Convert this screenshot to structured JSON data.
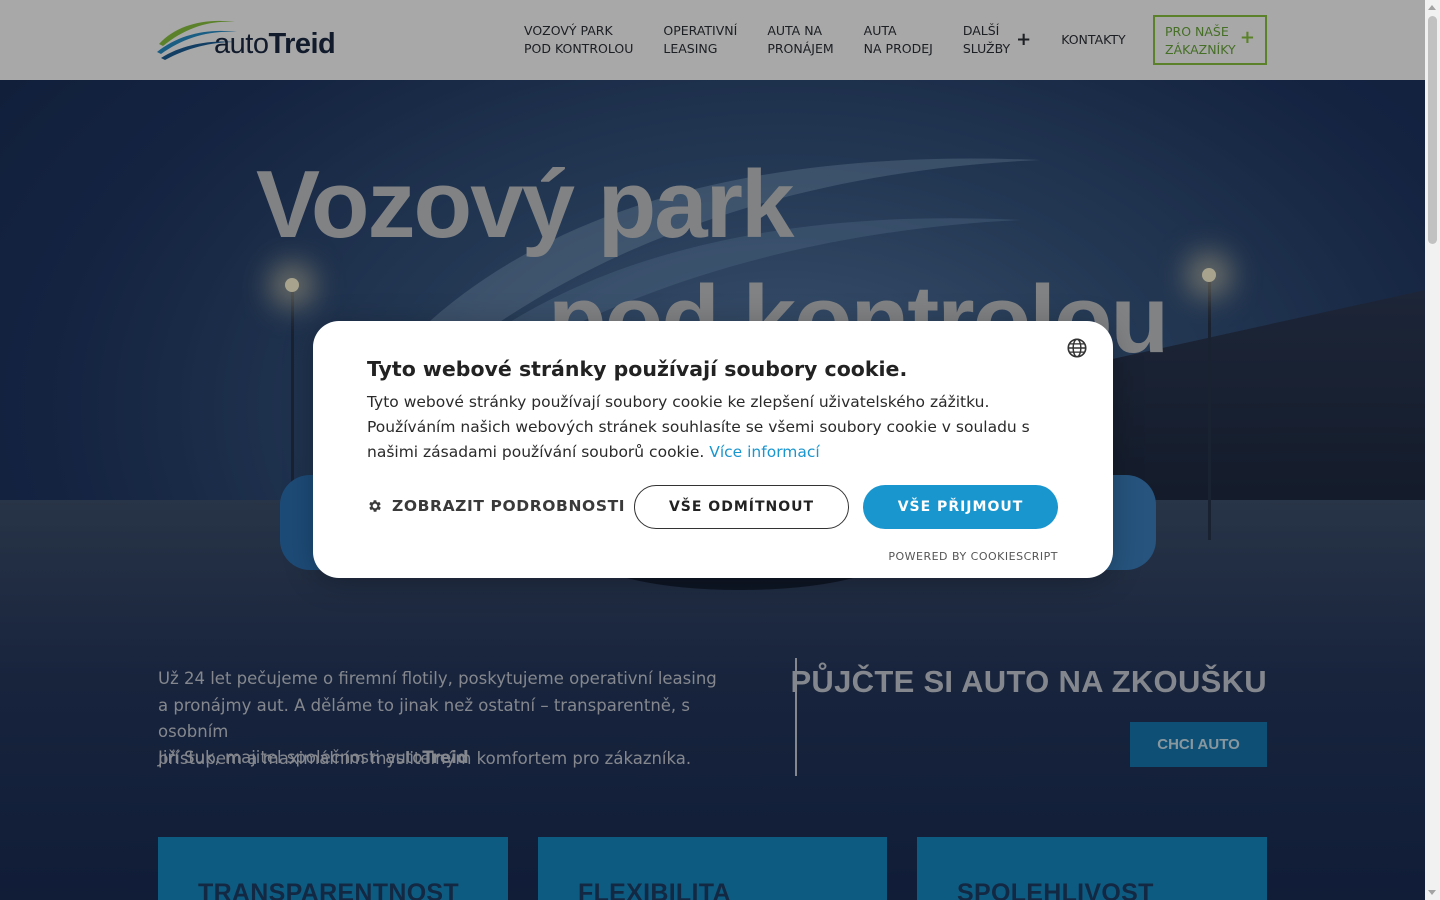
{
  "header": {
    "logo": {
      "text_light": "auto",
      "text_bold": "Treid"
    },
    "nav": [
      {
        "line1": "VOZOVÝ PARK",
        "line2": "POD KONTROLOU"
      },
      {
        "line1": "OPERATIVNÍ",
        "line2": "LEASING"
      },
      {
        "line1": "AUTA NA",
        "line2": "PRONÁJEM"
      },
      {
        "line1": "AUTA",
        "line2": "NA PRODEJ"
      },
      {
        "line1": "DALŠÍ",
        "line2": "SLUŽBY",
        "plus": "+"
      },
      {
        "label": "KONTAKTY"
      }
    ],
    "cta": {
      "line1": "PRO NAŠE",
      "line2": "ZÁKAZNÍKY",
      "plus": "+"
    }
  },
  "hero": {
    "title_line1": "Vozový park",
    "title_line2": "pod kontrolou",
    "intro_lines": [
      "Už 24 let pečujeme o firemní flotily, poskytujeme operativní leasing",
      "a pronájmy aut. A děláme to jinak než ostatní – transparentně, s osobním",
      "přístupem a maximálním myslitelným komfortem pro zákazníka."
    ],
    "signature_prefix": "Jiří Suk, majitel společnosti auto",
    "signature_bold": "Treid",
    "trial_title": "PŮJČTE SI AUTO NA ZKOUŠKU",
    "trial_button": "CHCI AUTO"
  },
  "features": [
    {
      "title": "TRANSPARENTNOST"
    },
    {
      "title": "FLEXIBILITA"
    },
    {
      "title": "SPOLEHLIVOST"
    }
  ],
  "cookie": {
    "title": "Tyto webové stránky používají soubory cookie.",
    "text": "Tyto webové stránky používají soubory cookie ke zlepšení uživatelského zážitku. Používáním našich webových stránek souhlasíte se všemi soubory cookie v souladu s našimi zásadami používání souborů cookie.",
    "link": "Více informací",
    "details_button": "ZOBRAZIT PODROBNOSTI",
    "decline_button": "VŠE ODMÍTNOUT",
    "accept_button": "VŠE PŘIJMOUT",
    "powered_by": "POWERED BY COOKIESCRIPT",
    "accent_color": "#1a96cf"
  },
  "icons": {
    "globe": "globe-icon",
    "gear": "gear-icon",
    "plus": "plus-icon"
  },
  "colors": {
    "brand_green": "#8ac640",
    "brand_blue": "#167ab2",
    "hero_dark": "#1a2d52"
  }
}
